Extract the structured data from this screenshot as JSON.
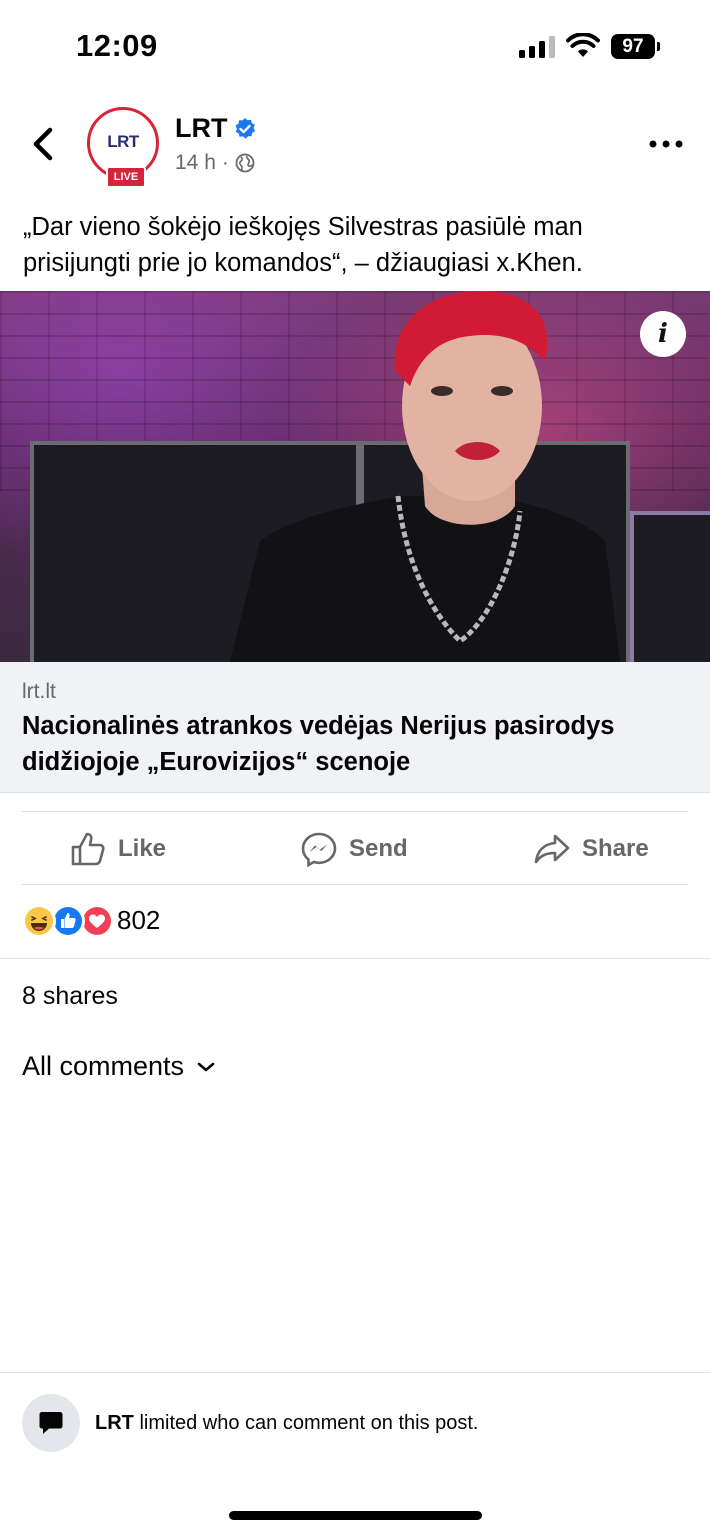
{
  "status_bar": {
    "time": "12:09",
    "battery": "97"
  },
  "header": {
    "avatar_text": "LRT",
    "live_label": "LIVE",
    "page_name": "LRT",
    "time_ago": "14 h",
    "separator": "·"
  },
  "post": {
    "text": "„Dar vieno šokėjo ieškojęs Silvestras pasiūlė man prisijungti prie jo komandos“, – džiaugiasi x.Khen."
  },
  "link_preview": {
    "domain": "lrt.lt",
    "title": "Nacionalinės atrankos vedėjas Nerijus pasirodys didžiojoje „Eurovizijos“ scenoje",
    "info_label": "i"
  },
  "actions": {
    "like": "Like",
    "send": "Send",
    "share": "Share"
  },
  "reactions": {
    "icons": [
      "haha",
      "like",
      "love"
    ],
    "count": "802"
  },
  "shares": "8 shares",
  "comments": {
    "filter_label": "All comments"
  },
  "footer": {
    "page_name": "LRT",
    "notice": " limited who can comment on this post."
  },
  "colors": {
    "accent_blue": "#1877f2",
    "live_red": "#d6243a",
    "secondary_text": "#65676b"
  }
}
